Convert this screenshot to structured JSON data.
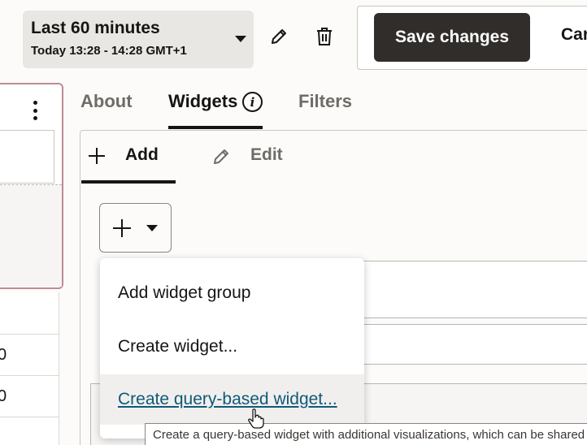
{
  "time_range": {
    "title": "Last 60 minutes",
    "subtitle": "Today 13:28 - 14:28 GMT+1"
  },
  "header_actions": {
    "save_label": "Save changes",
    "cancel_label": "Car"
  },
  "left_panel": {
    "cells": [
      "0",
      "0"
    ]
  },
  "tabs": [
    {
      "label": "About"
    },
    {
      "label": "Widgets"
    },
    {
      "label": "Filters"
    }
  ],
  "subtabs": [
    {
      "label": "Add"
    },
    {
      "label": "Edit"
    }
  ],
  "add_menu": {
    "items": [
      {
        "label": "Add widget group"
      },
      {
        "label": "Create widget..."
      },
      {
        "label": "Create query-based widget..."
      }
    ]
  },
  "tooltip": {
    "text": "Create a query-based widget with additional visualizations, which can be shared a"
  },
  "colors": {
    "accent_dark": "#312d2a",
    "link": "#0e5a7a",
    "left_card_border": "#c08a94"
  }
}
